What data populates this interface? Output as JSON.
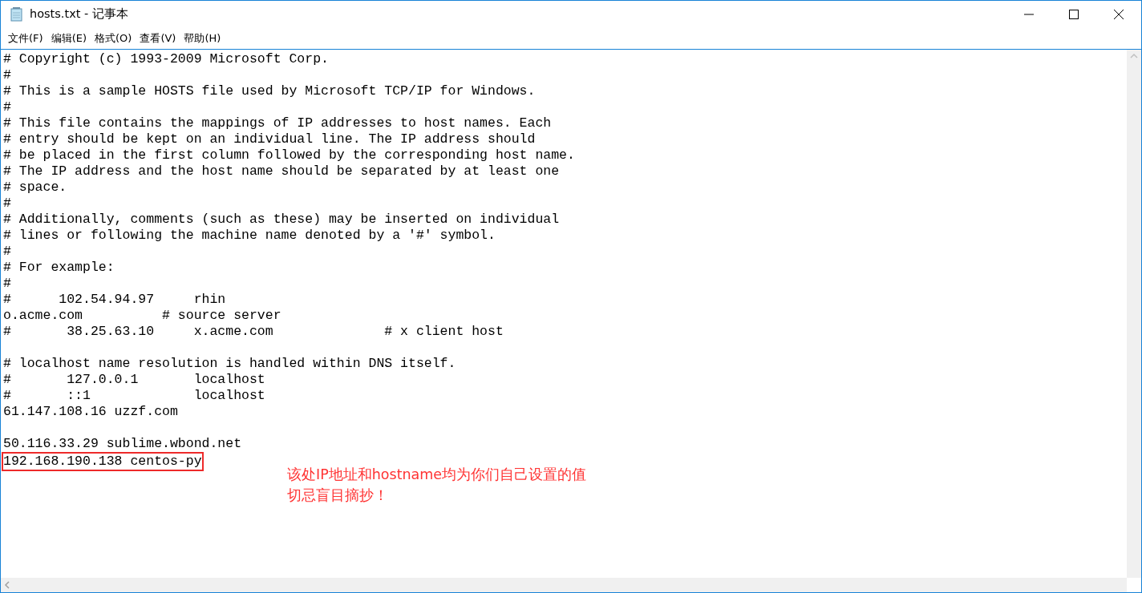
{
  "window": {
    "title": "hosts.txt - 记事本"
  },
  "menu": [
    "文件(F)",
    "编辑(E)",
    "格式(O)",
    "查看(V)",
    "帮助(H)"
  ],
  "lines": [
    {
      "kind": "text",
      "text": "# Copyright (c) 1993-2009 Microsoft Corp."
    },
    {
      "kind": "text",
      "text": "#"
    },
    {
      "kind": "text",
      "text": "# This is a sample HOSTS file used by Microsoft TCP/IP for Windows."
    },
    {
      "kind": "text",
      "text": "#"
    },
    {
      "kind": "text",
      "text": "# This file contains the mappings of IP addresses to host names. Each"
    },
    {
      "kind": "text",
      "text": "# entry should be kept on an individual line. The IP address should"
    },
    {
      "kind": "text",
      "text": "# be placed in the first column followed by the corresponding host name."
    },
    {
      "kind": "text",
      "text": "# The IP address and the host name should be separated by at least one"
    },
    {
      "kind": "text",
      "text": "# space."
    },
    {
      "kind": "text",
      "text": "#"
    },
    {
      "kind": "text",
      "text": "# Additionally, comments (such as these) may be inserted on individual"
    },
    {
      "kind": "text",
      "text": "# lines or following the machine name denoted by a '#' symbol."
    },
    {
      "kind": "text",
      "text": "#"
    },
    {
      "kind": "text",
      "text": "# For example:"
    },
    {
      "kind": "text",
      "text": "#"
    },
    {
      "kind": "text",
      "text": "#      102.54.94.97     rhin"
    },
    {
      "kind": "text",
      "text": "o.acme.com          # source server"
    },
    {
      "kind": "text",
      "text": "#       38.25.63.10     x.acme.com              # x client host"
    },
    {
      "kind": "blank"
    },
    {
      "kind": "text",
      "text": "# localhost name resolution is handled within DNS itself."
    },
    {
      "kind": "text",
      "text": "#       127.0.0.1       localhost"
    },
    {
      "kind": "text",
      "text": "#       ::1             localhost"
    },
    {
      "kind": "text",
      "text": "61.147.108.16 uzzf.com"
    },
    {
      "kind": "blank"
    },
    {
      "kind": "text",
      "text": "50.116.33.29 sublime.wbond.net"
    },
    {
      "kind": "boxed",
      "text": "192.168.190.138 centos-py"
    }
  ],
  "annotation": [
    "该处IP地址和hostname均为你们自己设置的值",
    "切忌盲目摘抄！"
  ]
}
